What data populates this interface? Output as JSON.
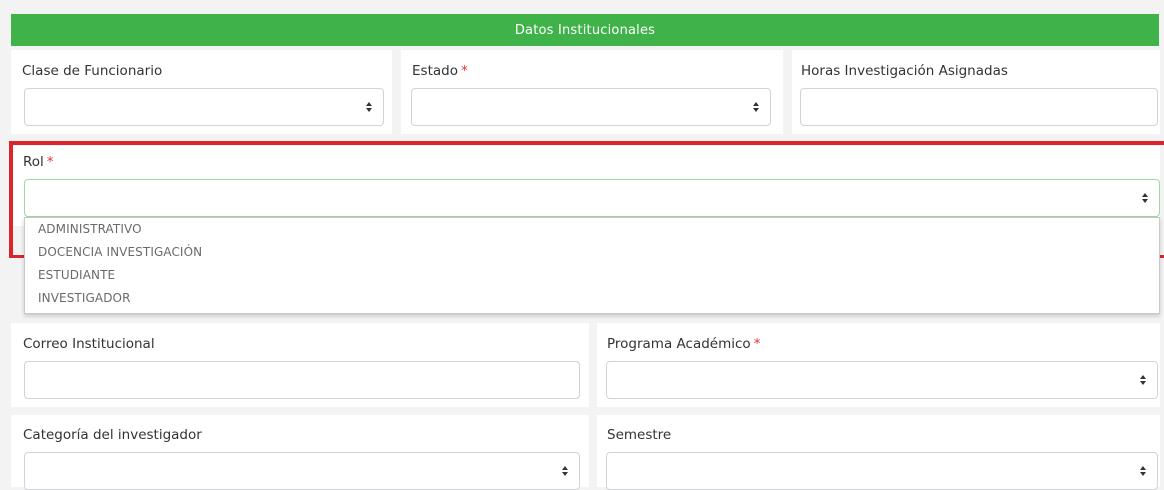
{
  "header": {
    "title": "Datos Institucionales"
  },
  "fields": {
    "clase_funcionario": {
      "label": "Clase de Funcionario",
      "value": ""
    },
    "estado": {
      "label": "Estado",
      "required_mark": "*",
      "value": ""
    },
    "horas_investigacion": {
      "label": "Horas Investigación Asignadas",
      "value": ""
    },
    "rol": {
      "label": "Rol",
      "required_mark": "*",
      "value": ""
    },
    "correo_institucional": {
      "label": "Correo Institucional",
      "value": ""
    },
    "programa_academico": {
      "label": "Programa Académico",
      "required_mark": "*",
      "value": ""
    },
    "categoria_investigador": {
      "label": "Categoría del investigador",
      "value": ""
    },
    "semestre": {
      "label": "Semestre",
      "value": ""
    }
  },
  "rol_dropdown": {
    "options": [
      "ADMINISTRATIVO",
      "DOCENCIA INVESTIGACIÓN",
      "ESTUDIANTE",
      "INVESTIGADOR"
    ]
  },
  "colors": {
    "header_bg": "#3fb34a",
    "required": "#e0342e",
    "highlight_box": "#d8262c",
    "focus_border": "#9fd89e"
  }
}
